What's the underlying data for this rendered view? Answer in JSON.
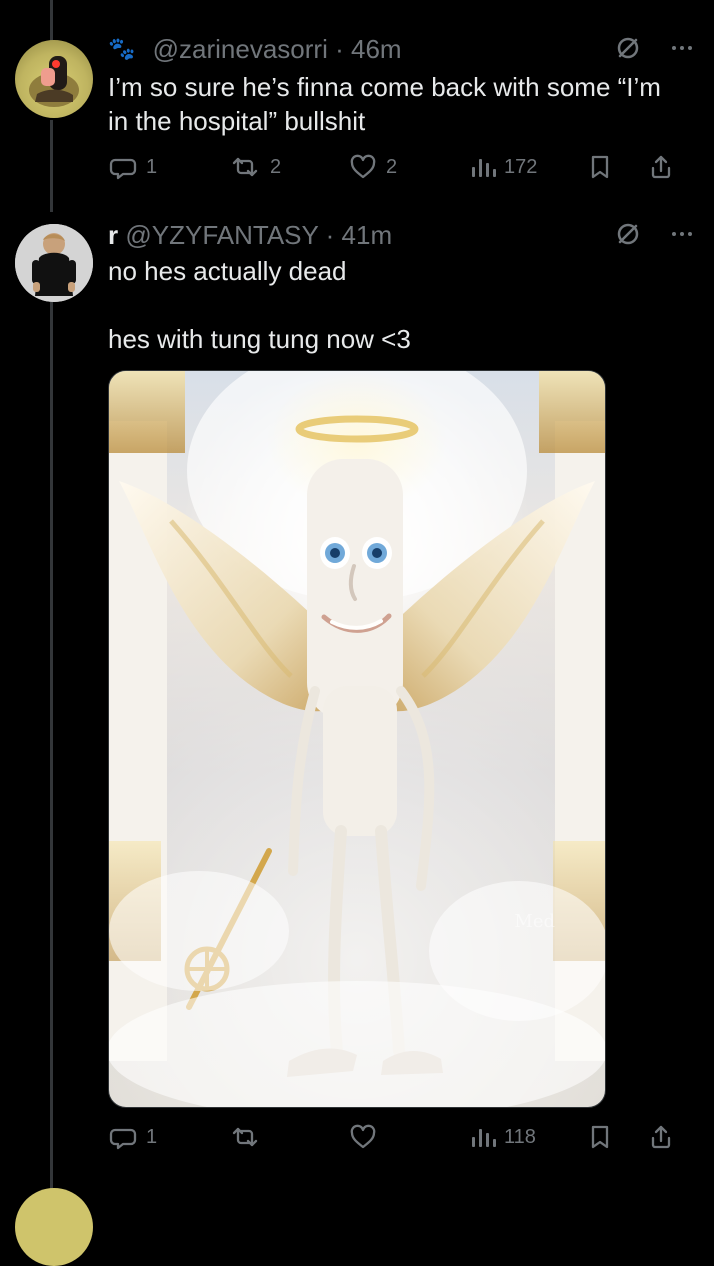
{
  "tweets": [
    {
      "avatar_icon": "profile-avatar",
      "badge_icon": "paw-icon",
      "display_name": "",
      "handle": "@zarinevasorri",
      "separator": "·",
      "time": "46m",
      "text": "I’m so sure he’s finna come back with some “I’m\nin the hospital” bullshit",
      "metrics": {
        "reply": "1",
        "repost": "2",
        "like": "2",
        "views": "172"
      }
    },
    {
      "avatar_icon": "profile-avatar",
      "badge_icon": "",
      "display_name": "r",
      "handle": "@YZYFANTASY",
      "separator": "·",
      "time": "41m",
      "text": "no hes actually dead\n\nhes with tung tung now <3",
      "media_icon": "angel-image",
      "metrics": {
        "reply": "1",
        "repost": "",
        "like": "",
        "views": "118"
      },
      "watermark": "Med"
    }
  ],
  "icons": {
    "top_left": "grok-icon",
    "top_right": "more-icon",
    "reply": "reply-icon",
    "repost": "repost-icon",
    "like": "like-icon",
    "views": "views-icon",
    "bookmark": "bookmark-icon",
    "share": "share-icon"
  },
  "colors": {
    "background": "#000000",
    "text": "#e7e9ea",
    "muted": "#71767b",
    "line": "#333639"
  }
}
